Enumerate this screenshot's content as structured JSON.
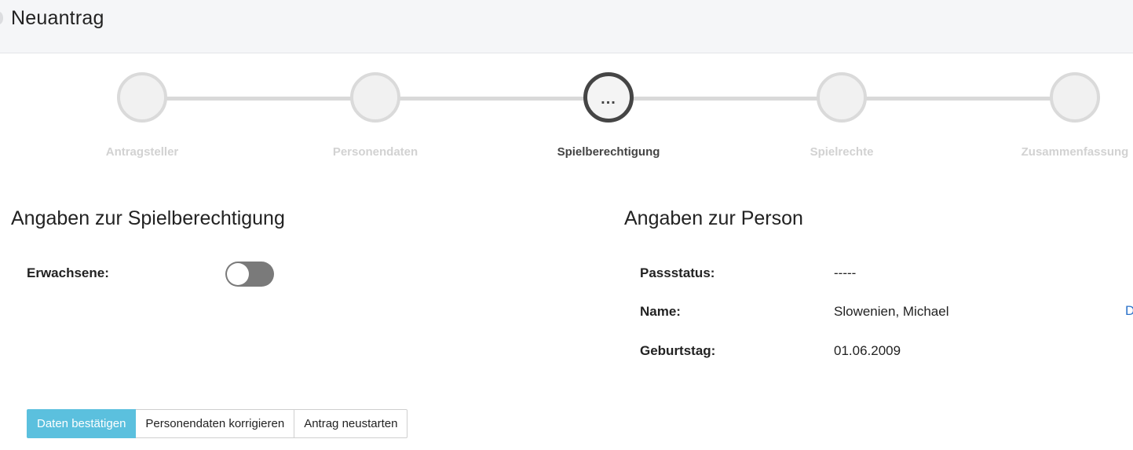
{
  "header": {
    "title": "Neuantrag"
  },
  "stepper": {
    "steps": [
      {
        "label": "Antragsteller",
        "marker": ""
      },
      {
        "label": "Personendaten",
        "marker": ""
      },
      {
        "label": "Spielberechtigung",
        "marker": "..."
      },
      {
        "label": "Spielrechte",
        "marker": ""
      },
      {
        "label": "Zusammenfassung",
        "marker": ""
      }
    ],
    "active_index": 2
  },
  "left": {
    "title": "Angaben zur Spielberechtigung",
    "adult_label": "Erwachsene:",
    "adult_toggle_on": false
  },
  "right": {
    "title": "Angaben zur Person",
    "pass_label": "Passstatus:",
    "pass_value": "-----",
    "name_label": "Name:",
    "name_value": "Slowenien, Michael",
    "name_link_partial": "D",
    "birth_label": "Geburtstag:",
    "birth_value": "01.06.2009"
  },
  "actions": {
    "confirm": "Daten bestätigen",
    "correct": "Personendaten korrigieren",
    "restart": "Antrag neustarten"
  },
  "colors": {
    "primary": "#5bc0de",
    "active_step": "#454545",
    "inactive_step": "#dadada",
    "link": "#2b72c9"
  }
}
